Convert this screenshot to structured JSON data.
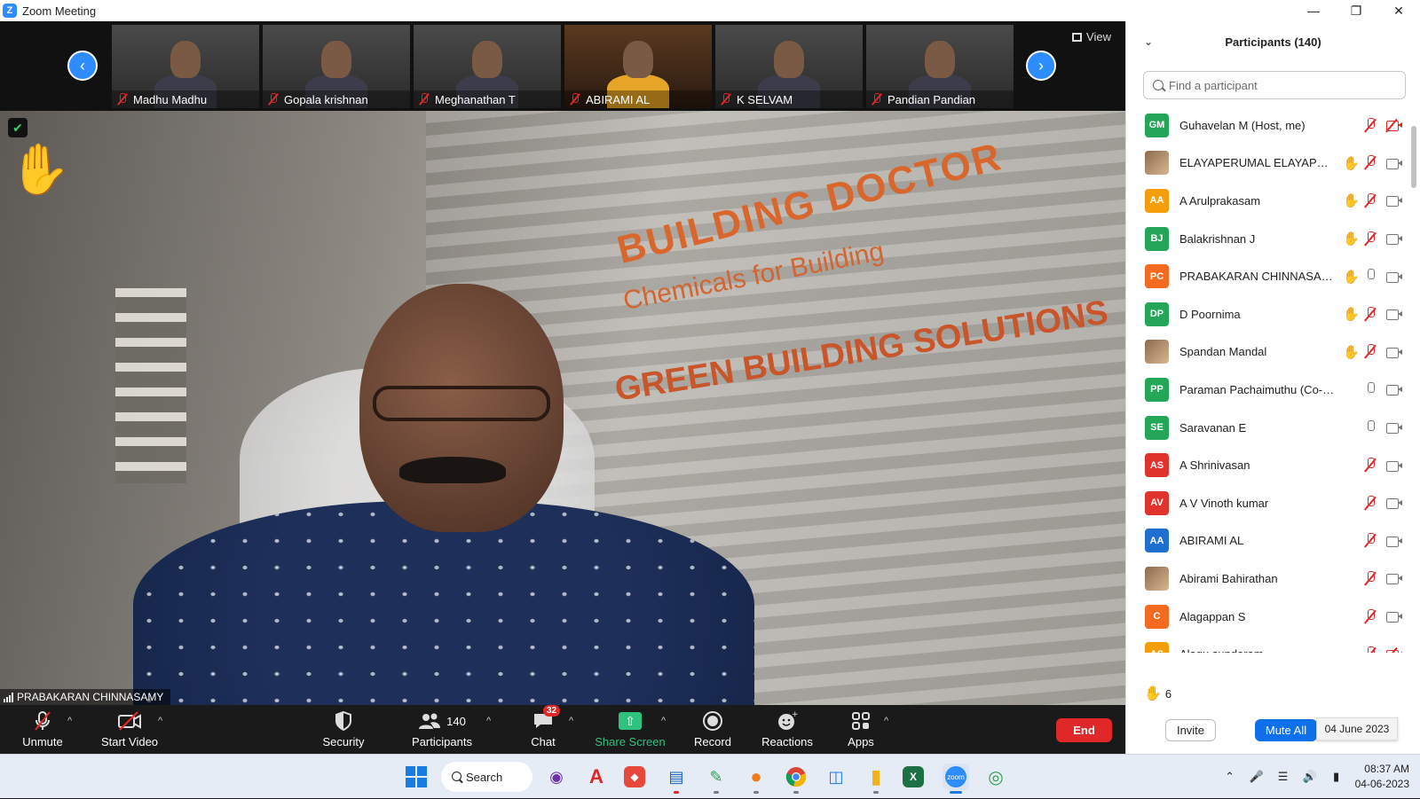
{
  "window": {
    "title": "Zoom Meeting",
    "logo_letter": "Z"
  },
  "strip": {
    "view_label": "View",
    "thumbnails": [
      {
        "name": "Madhu Madhu"
      },
      {
        "name": "Gopala krishnan"
      },
      {
        "name": "Meghanathan T"
      },
      {
        "name": "ABIRAMI AL"
      },
      {
        "name": "K SELVAM"
      },
      {
        "name": "Pandian Pandian"
      }
    ]
  },
  "main_video": {
    "speaker_name": "PRABAKARAN CHINNASAMY",
    "wall_text": [
      "BUILDING DOCTOR",
      "Chemicals for Building",
      "GREEN BUILDING SOLUTIONS"
    ]
  },
  "toolbar": {
    "unmute_label": "Unmute",
    "start_video_label": "Start Video",
    "security_label": "Security",
    "participants_label": "Participants",
    "participants_count": "140",
    "chat_label": "Chat",
    "chat_badge": "32",
    "share_screen_label": "Share Screen",
    "record_label": "Record",
    "reactions_label": "Reactions",
    "apps_label": "Apps",
    "end_label": "End",
    "share_color": "#2ec27e",
    "end_color": "#e02828"
  },
  "panel": {
    "title": "Participants (140)",
    "search_placeholder": "Find a participant",
    "participants": [
      {
        "initials": "GM",
        "name": "Guhavelan M (Host, me)",
        "color": "#23a658",
        "hand": false,
        "mic": "off",
        "cam": "off-slash"
      },
      {
        "initials": "",
        "name": "ELAYAPERUMAL ELAYAPERU...",
        "color": "photo",
        "hand": true,
        "mic": "off",
        "cam": "off"
      },
      {
        "initials": "AA",
        "name": "A Arulprakasam",
        "color": "#f59e0b",
        "hand": true,
        "mic": "off",
        "cam": "off"
      },
      {
        "initials": "BJ",
        "name": "Balakrishnan J",
        "color": "#23a658",
        "hand": true,
        "mic": "off",
        "cam": "off"
      },
      {
        "initials": "PC",
        "name": "PRABAKARAN CHINNASAMY",
        "color": "#f26b21",
        "hand": true,
        "mic": "on",
        "cam": "off"
      },
      {
        "initials": "DP",
        "name": "D Poornima",
        "color": "#23a658",
        "hand": true,
        "mic": "off",
        "cam": "off"
      },
      {
        "initials": "",
        "name": "Spandan Mandal",
        "color": "photo",
        "hand": true,
        "mic": "off",
        "cam": "off"
      },
      {
        "initials": "PP",
        "name": "Paraman Pachaimuthu (Co-host)",
        "color": "#23a658",
        "hand": false,
        "mic": "on",
        "cam": "off"
      },
      {
        "initials": "SE",
        "name": "Saravanan E",
        "color": "#23a658",
        "hand": false,
        "mic": "on",
        "cam": "off"
      },
      {
        "initials": "AS",
        "name": "A Shrinivasan",
        "color": "#e0332c",
        "hand": false,
        "mic": "off",
        "cam": "off"
      },
      {
        "initials": "AV",
        "name": "A V Vinoth kumar",
        "color": "#e0332c",
        "hand": false,
        "mic": "off",
        "cam": "off"
      },
      {
        "initials": "AA",
        "name": "ABIRAMI AL",
        "color": "#1f6fd1",
        "hand": false,
        "mic": "off",
        "cam": "off"
      },
      {
        "initials": "",
        "name": "Abirami Bahirathan",
        "color": "photo",
        "hand": false,
        "mic": "off",
        "cam": "off"
      },
      {
        "initials": "C",
        "name": "Alagappan S",
        "color": "#f26b21",
        "hand": false,
        "mic": "off",
        "cam": "off"
      },
      {
        "initials": "AS",
        "name": "Alagu sundaram",
        "color": "#f59e0b",
        "hand": false,
        "mic": "off",
        "cam": "off-slash"
      }
    ],
    "raised_hands_count": "6",
    "invite_label": "Invite",
    "mute_all_label": "Mute All",
    "date_tooltip": "04 June 2023"
  },
  "taskbar": {
    "search_label": "Search",
    "time": "08:37 AM",
    "date": "04-06-2023",
    "apps": [
      "start-icon",
      "github-icon",
      "acrobat-icon",
      "anydesk-icon",
      "files-app-icon",
      "editor-icon",
      "firefox-icon",
      "chrome-icon",
      "remote-desktop-icon",
      "file-explorer-icon",
      "excel-icon",
      "zoom-icon",
      "globe-app-icon"
    ]
  }
}
